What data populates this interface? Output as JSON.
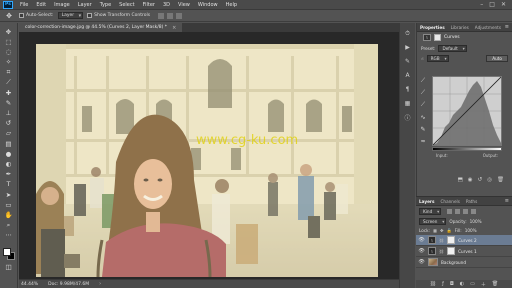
{
  "app": {
    "logo": "Ps"
  },
  "menu": [
    "File",
    "Edit",
    "Image",
    "Layer",
    "Type",
    "Select",
    "Filter",
    "3D",
    "View",
    "Window",
    "Help"
  ],
  "window_controls": [
    "–",
    "□",
    "✕"
  ],
  "options_bar": {
    "auto_select_label": "Auto-Select:",
    "auto_select_value": "Layer",
    "show_transform_label": "Show Transform Controls"
  },
  "document": {
    "tab_title": "color-correction-image.jpg @ 44.5% (Curves 2, Layer Mask/8) *",
    "close_glyph": "×",
    "zoom": "44.44%",
    "doc_info": "Doc: 9.98M/47.6M"
  },
  "properties_panel": {
    "tabs": [
      "Properties",
      "Libraries",
      "Adjustments"
    ],
    "adjustment_name": "Curves",
    "preset_label": "Preset:",
    "preset_value": "Default",
    "channel_value": "RGB",
    "auto_label": "Auto",
    "input_label": "Input:",
    "output_label": "Output:"
  },
  "layers_panel": {
    "tabs": [
      "Layers",
      "Channels",
      "Paths"
    ],
    "filter_label": "Kind",
    "blend_mode": "Screen",
    "opacity_label": "Opacity:",
    "opacity_value": "100%",
    "lock_label": "Lock:",
    "fill_label": "Fill:",
    "fill_value": "100%",
    "layers": [
      {
        "name": "Curves 2",
        "selected": true
      },
      {
        "name": "Curves 1",
        "selected": false
      },
      {
        "name": "Background",
        "selected": false
      }
    ]
  },
  "watermark": "www.cg-ku.com",
  "colors": {
    "menubar": "#4a4a4a",
    "panel": "#535353",
    "selection": "#6b7c93",
    "photo_overlay": "#fff6c8"
  }
}
